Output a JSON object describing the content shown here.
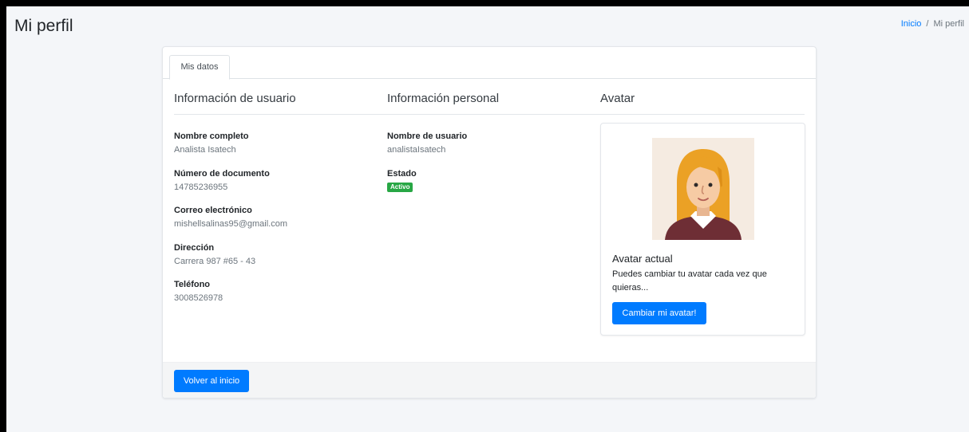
{
  "page": {
    "title": "Mi perfil"
  },
  "breadcrumb": {
    "home": "Inicio",
    "separator": "/",
    "current": "Mi perfil"
  },
  "tabs": [
    {
      "label": "Mis datos"
    }
  ],
  "sections": {
    "user_info": "Información de usuario",
    "personal_info": "Información personal",
    "avatar": "Avatar"
  },
  "user_info": [
    {
      "label": "Nombre completo",
      "value": "Analista Isatech"
    },
    {
      "label": "Número de documento",
      "value": "14785236955"
    },
    {
      "label": "Correo electrónico",
      "value": "mishellsalinas95@gmail.com"
    },
    {
      "label": "Dirección",
      "value": "Carrera 987 #65 - 43"
    },
    {
      "label": "Teléfono",
      "value": "3008526978"
    }
  ],
  "personal_info": {
    "username_label": "Nombre de usuario",
    "username_value": "analistaIsatech",
    "status_label": "Estado",
    "status_badge": "Activo"
  },
  "avatar": {
    "title": "Avatar actual",
    "description": "Puedes cambiar tu avatar cada vez que quieras...",
    "button": "Cambiar mi avatar!"
  },
  "footer": {
    "back_button": "Volver al inicio"
  },
  "colors": {
    "primary": "#007bff",
    "success": "#28a745",
    "background": "#f4f6f9"
  },
  "icons": {
    "avatar": "woman-avatar-illustration"
  }
}
